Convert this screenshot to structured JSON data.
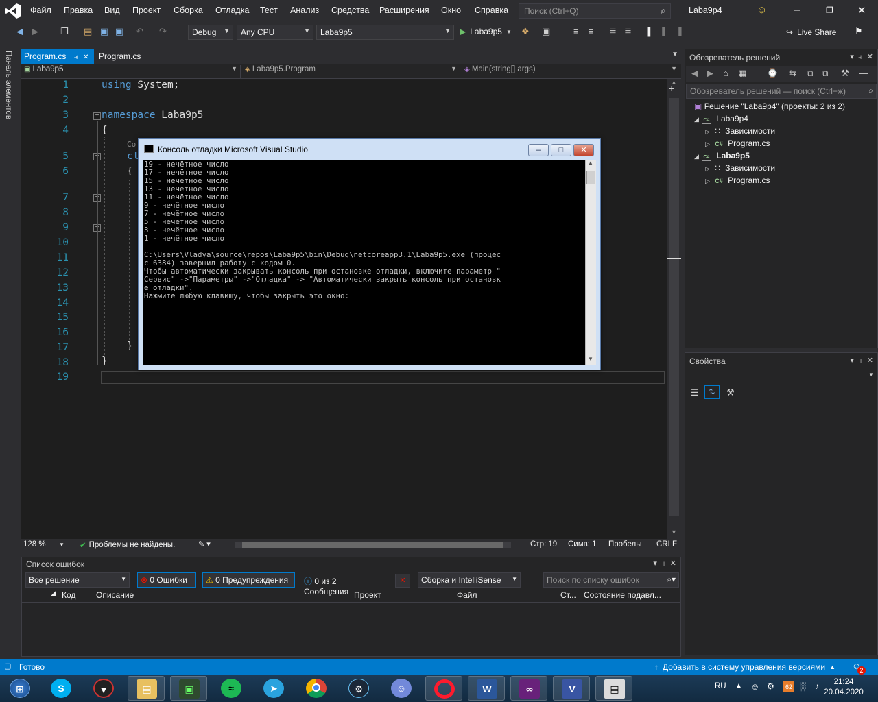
{
  "menubar": {
    "items": [
      "Файл",
      "Правка",
      "Вид",
      "Проект",
      "Сборка",
      "Отладка",
      "Тест",
      "Анализ",
      "Средства",
      "Расширения",
      "Окно",
      "Справка"
    ],
    "search_placeholder": "Поиск (Ctrl+Q)",
    "solution_name": "Laba9p4"
  },
  "toolbar": {
    "config": "Debug",
    "platform": "Any CPU",
    "startup_project": "Laba9p5",
    "run_label": "Laba9p5",
    "live_share": "Live Share"
  },
  "toolbox_tab": "Панель элементов",
  "tabs": [
    {
      "label": "Program.cs",
      "active": true
    },
    {
      "label": "Program.cs",
      "active": false
    }
  ],
  "navbar": {
    "project": "Laba9p5",
    "type": "Laba9p5.Program",
    "member": "Main(string[] args)"
  },
  "editor": {
    "line_numbers": [
      "1",
      "2",
      "3",
      "4",
      "5",
      "6",
      "7",
      "8",
      "9",
      "10",
      "11",
      "12",
      "13",
      "14",
      "15",
      "16",
      "17",
      "18",
      "19"
    ],
    "lines": {
      "l1_kw": "using",
      "l1_rest": " System;",
      "l3_kw": "namespace",
      "l3_rest": " Laba9p5",
      "l4": "{",
      "l5_partial": "Co",
      "l6_partial": "cl",
      "l7": "{",
      "l17": "}",
      "l18": "}"
    }
  },
  "editor_status": {
    "zoom": "128 %",
    "issues": "Проблемы не найдены.",
    "line": "Стр: 19",
    "col": "Симв: 1",
    "spaces": "Пробелы",
    "eol": "CRLF"
  },
  "console": {
    "title": "Консоль отладки Microsoft Visual Studio",
    "text": "19 - нечётное число\n17 - нечётное число\n15 - нечётное число\n13 - нечётное число\n11 - нечётное число\n9 - нечётное число\n7 - нечётное число\n5 - нечётное число\n3 - нечётное число\n1 - нечётное число\n\nC:\\Users\\Vladya\\source\\repos\\Laba9p5\\bin\\Debug\\netcoreapp3.1\\Laba9p5.exe (процес\nс 6384) завершил работу с кодом 0.\nЧтобы автоматически закрывать консоль при остановке отладки, включите параметр \"\nСервис\" ->\"Параметры\" ->\"Отладка\" -> \"Автоматически закрыть консоль при остановк\nе отладки\".\nНажмите любую клавишу, чтобы закрыть это окно:\n_"
  },
  "solution_explorer": {
    "title": "Обозреватель решений",
    "search_placeholder": "Обозреватель решений — поиск (Ctrl+ж)",
    "solution": "Решение \"Laba9p4\" (проекты: 2 из 2)",
    "projects": [
      {
        "name": "Laba9p4",
        "deps": "Зависимости",
        "file": "Program.cs"
      },
      {
        "name": "Laba9p5",
        "deps": "Зависимости",
        "file": "Program.cs"
      }
    ]
  },
  "properties": {
    "title": "Свойства"
  },
  "error_list": {
    "title": "Список ошибок",
    "scope": "Все решение",
    "errors": "0 Ошибки",
    "warnings": "0 Предупреждения",
    "messages": "0 из 2 Сообщения",
    "build_filter": "Сборка и IntelliSense",
    "search_placeholder": "Поиск по списку ошибок",
    "columns": [
      "Код",
      "Описание",
      "Проект",
      "Файл",
      "Ст...",
      "Состояние подавл..."
    ]
  },
  "statusbar": {
    "ready": "Готово",
    "source_control": "Добавить в систему управления версиями",
    "notifications": "2"
  },
  "taskbar": {
    "lang": "RU",
    "battery": "62",
    "time": "21:24",
    "date": "20.04.2020"
  },
  "colors": {
    "accent": "#007acc",
    "editor_bg": "#1e1e1e",
    "keyword": "#569cd6",
    "line_number": "#2b91af"
  }
}
